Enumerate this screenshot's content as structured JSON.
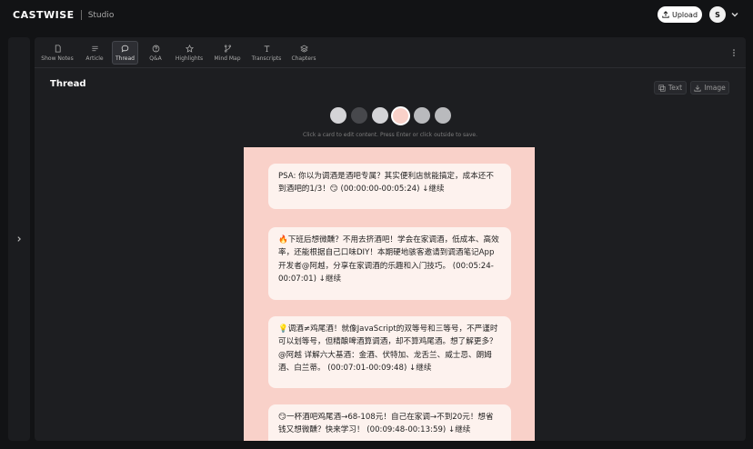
{
  "app": {
    "name": "CASTWISE",
    "section": "Studio"
  },
  "header": {
    "upload_label": "Upload",
    "user_initial": "S"
  },
  "tabs": [
    {
      "label": "Show Notes",
      "icon": "doc-icon"
    },
    {
      "label": "Article",
      "icon": "lines-icon"
    },
    {
      "label": "Thread",
      "icon": "chat-bubble-icon",
      "active": true
    },
    {
      "label": "Q&A",
      "icon": "question-icon"
    },
    {
      "label": "Highlights",
      "icon": "star-icon"
    },
    {
      "label": "Mind Map",
      "icon": "mindmap-icon"
    },
    {
      "label": "Transcripts",
      "icon": "text-t-icon"
    },
    {
      "label": "Chapters",
      "icon": "layers-icon"
    }
  ],
  "page": {
    "title": "Thread",
    "text_button": "Text",
    "image_button": "Image",
    "hint": "Click a card to edit content. Press Enter or click outside to save."
  },
  "swatches": [
    {
      "color": "#d4d4d7",
      "selected": false
    },
    {
      "color": "#47484c",
      "selected": false
    },
    {
      "color": "#d4d4d7",
      "selected": false
    },
    {
      "color": "#f9d1c9",
      "selected": true
    },
    {
      "color": "#b9babd",
      "selected": false
    },
    {
      "color": "#b9babd",
      "selected": false
    }
  ],
  "cards": [
    "PSA: 你以为调酒是酒吧专属？其实便利店就能搞定，成本还不到酒吧的1/3！😏  (00:00:00-00:05:24) ↓继续",
    "🔥下班后想微醺？不用去挤酒吧！学会在家调酒，低成本、高效率，还能根据自己口味DIY！本期硬地骇客邀请到调酒笔记App开发者@阿越，分享在家调酒的乐趣和入门技巧。  (00:05:24-00:07:01) ↓继续",
    "💡调酒≠鸡尾酒！就像JavaScript的双等号和三等号，不严谨时可以划等号，但精酿啤酒算调酒，却不算鸡尾酒。想了解更多？@阿越 详解六大基酒：金酒、伏特加、龙舌兰、威士忌、朗姆酒、白兰蒂。 (00:07:01-00:09:48) ↓继续",
    "😏一杯酒吧鸡尾酒→68-108元！自己在家调→不到20元！想省钱又想微醺？快来学习！   (00:09:48-00:13:59) ↓继续"
  ]
}
